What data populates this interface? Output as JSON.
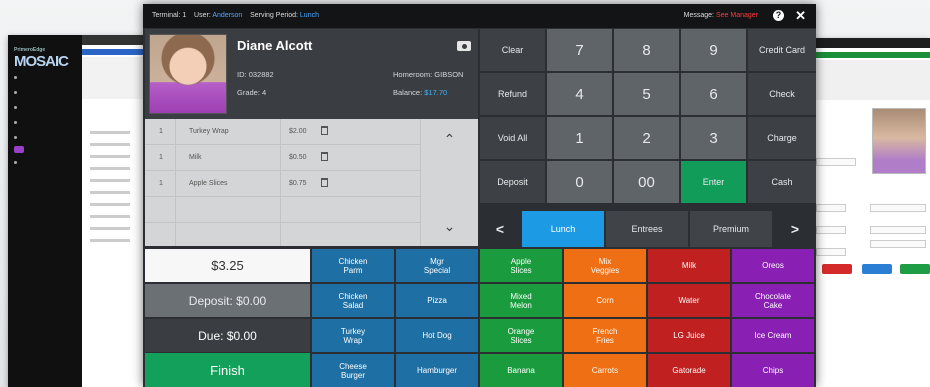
{
  "terminal_bar": {
    "terminal_label": "Terminal:",
    "terminal": "1",
    "user_label": "User:",
    "user": "Anderson",
    "period_label": "Serving Period:",
    "period": "Lunch",
    "message_label": "Message:",
    "message": "See Manager",
    "help": "?",
    "close": "✕"
  },
  "student": {
    "name": "Diane Alcott",
    "id_label": "ID:",
    "id": "032882",
    "grade_label": "Grade:",
    "grade": "4",
    "homeroom_label": "Homeroom:",
    "homeroom": "GIBSON",
    "balance_label": "Balance:",
    "balance": "$17.70"
  },
  "order_items": [
    {
      "qty": "1",
      "name": "Turkey Wrap",
      "price": "$2.00"
    },
    {
      "qty": "1",
      "name": "Milk",
      "price": "$0.50"
    },
    {
      "qty": "1",
      "name": "Apple Slices",
      "price": "$0.75"
    }
  ],
  "keypad": {
    "left": [
      "Clear",
      "Refund",
      "Void All",
      "Deposit"
    ],
    "right": [
      "Credit Card",
      "Check",
      "Charge",
      "Cash"
    ],
    "digits": [
      "7",
      "8",
      "9",
      "4",
      "5",
      "6",
      "1",
      "2",
      "3",
      "0",
      "00"
    ],
    "enter": "Enter"
  },
  "categories": {
    "prev": "<",
    "next": ">",
    "items": [
      "Lunch",
      "Entrees",
      "Premium"
    ],
    "active": "Lunch"
  },
  "totals": {
    "total": "$3.25",
    "deposit": "Deposit: $0.00",
    "due": "Due: $0.00",
    "finish": "Finish"
  },
  "products": [
    [
      "Chicken\nParm",
      "Mgr\nSpecial",
      "Apple\nSlices",
      "Mix\nVeggies",
      "Milk",
      "Oreos"
    ],
    [
      "Chicken\nSalad",
      "Pizza",
      "Mixed\nMelon",
      "Corn",
      "Water",
      "Chocolate\nCake"
    ],
    [
      "Turkey\nWrap",
      "Hot Dog",
      "Orange\nSlices",
      "French\nFries",
      "LG Juice",
      "Ice Cream"
    ],
    [
      "Cheese\nBurger",
      "Hamburger",
      "Banana",
      "Carrots",
      "Gatorade",
      "Chips"
    ]
  ],
  "bg_left": {
    "logo": "MOSAIC",
    "logo_small": "PrimeroEdge"
  },
  "colors": {
    "accent_blue": "#1c9be4",
    "green": "#129c59",
    "orange": "#ee6f14",
    "red": "#c0201f",
    "purple": "#8a1fb3",
    "dark_blue": "#1e6fa3"
  }
}
